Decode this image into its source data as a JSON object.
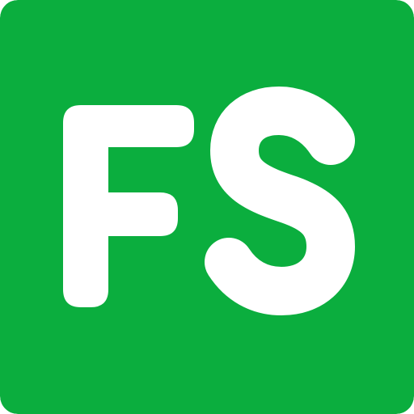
{
  "logo": {
    "text": "FS",
    "background_color": "#0BAE3E",
    "letter_color": "#FFFFFF"
  }
}
